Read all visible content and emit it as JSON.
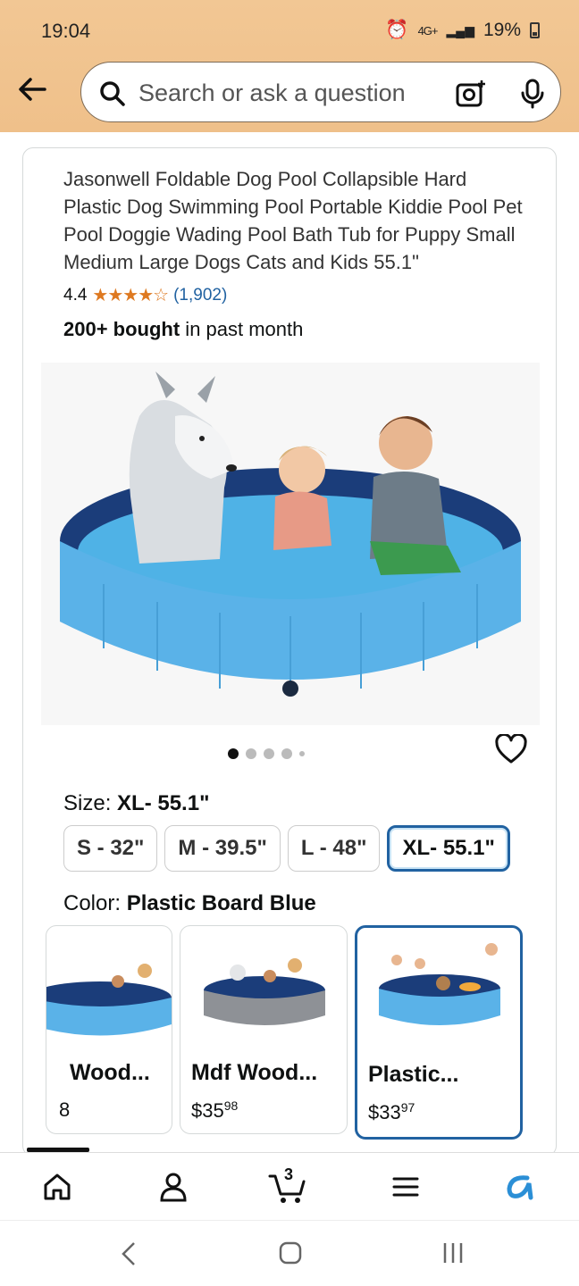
{
  "status": {
    "time": "19:04",
    "network": "4G+",
    "battery": "19%"
  },
  "search": {
    "placeholder": "Search or ask a question"
  },
  "product": {
    "title": "Jasonwell Foldable Dog Pool Collapsible Hard Plastic Dog Swimming Pool Portable Kiddie Pool Pet Pool Doggie Wading Pool Bath Tub for Puppy Small Medium Large Dogs Cats and Kids 55.1\"",
    "rating": "4.4",
    "stars": "★★★★☆",
    "rating_count": "(1,902)",
    "bought_bold": "200+ bought",
    "bought_rest": " in past month",
    "image_count": 5,
    "current_image": 1
  },
  "size": {
    "label": "Size: ",
    "selected": "XL- 55.1\"",
    "options": [
      "S - 32\"",
      "M - 39.5\"",
      "L - 48\"",
      "XL- 55.1\""
    ]
  },
  "color": {
    "label": "Color: ",
    "selected": "Plastic Board Blue",
    "options": [
      {
        "name": "Wood...",
        "price_main": "",
        "price_cents": "8"
      },
      {
        "name": "Mdf Wood...",
        "price_main": "$35",
        "price_cents": "98"
      },
      {
        "name": "Plastic...",
        "price_main": "$33",
        "price_cents": "97"
      }
    ]
  },
  "tabs": {
    "cart_count": "3"
  },
  "colors": {
    "accent": "#2162a1",
    "star": "#de7921",
    "header": "#f2c794"
  }
}
